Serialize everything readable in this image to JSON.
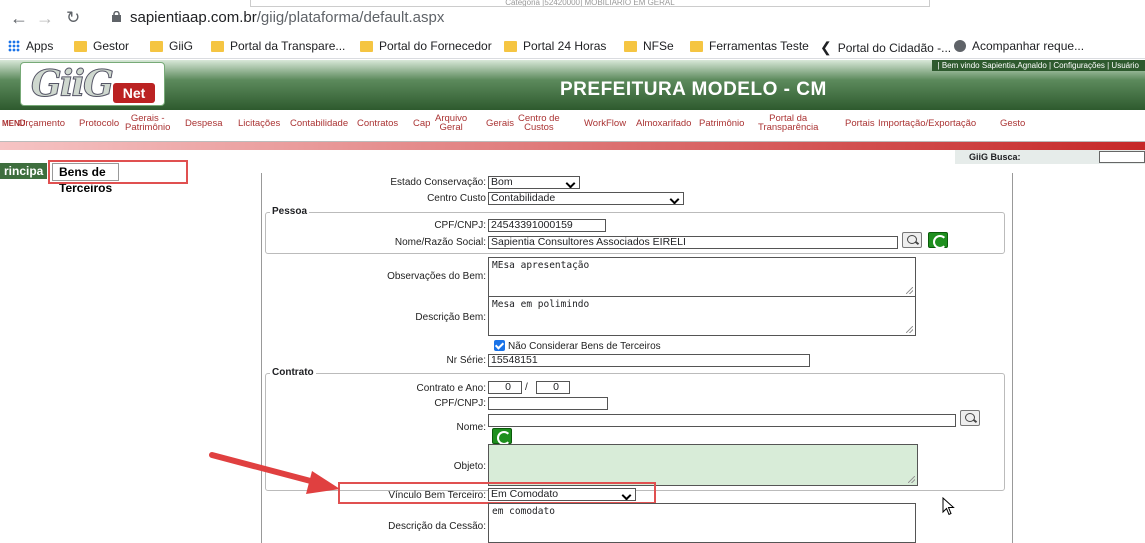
{
  "browser": {
    "url_domain": "sapientiaap.com.br",
    "url_path": "/giig/plataforma/default.aspx",
    "ghost_text": "Categoria [52420000] MOBILIARIO EM GERAL",
    "bookmarks": [
      "Apps",
      "Gestor",
      "GiiG",
      "Portal da Transpare...",
      "Portal do Fornecedor",
      "Portal 24 Horas",
      "NFSe",
      "Ferramentas Teste",
      "Portal do Cidadão -...",
      "Acompanhar reque..."
    ]
  },
  "header": {
    "topbar": "| Bem vindo Sapientia.Agnaldo   |  Configurações   |  Usuário",
    "logo_main": "GiiG",
    "logo_sub": "Net",
    "title": "PREFEITURA MODELO - CM"
  },
  "menu": {
    "tag": "MENU",
    "items": [
      "Orçamento",
      "Protocolo",
      "Gerais -\nPatrimônio",
      "Despesa",
      "Licitações",
      "Contabilidade",
      "Contratos",
      "Cap",
      "Arquivo\nGeral",
      "Gerais",
      "Centro de\nCustos",
      "WorkFlow",
      "Almoxarifado",
      "Patrimônio",
      "Portal da\nTransparência",
      "Portais",
      "Importação/Exportação",
      "Gesto"
    ]
  },
  "busca": {
    "label": "GiiG Busca:"
  },
  "tabs": {
    "principal": "rincipa",
    "active": "Bens de Terceiros"
  },
  "form": {
    "estado_label": "Estado Conservação:",
    "estado_value": "Bom",
    "centro_label": "Centro Custo",
    "centro_value": "Contabilidade",
    "pessoa_legend": "Pessoa",
    "cpf_label": "CPF/CNPJ:",
    "cpf_value": "24543391000159",
    "nome_label": "Nome/Razão Social:",
    "nome_value": "Sapientia Consultores Associados EIRELI",
    "obs_label": "Observações do Bem:",
    "obs_value": "MEsa apresentação",
    "desc_label": "Descrição Bem:",
    "desc_value": "Mesa em polimindo",
    "nao_considerar": "Não Considerar Bens de Terceiros",
    "serie_label": "Nr Série:",
    "serie_value": "15548151",
    "contrato_legend": "Contrato",
    "contrato_ano_label": "Contrato e Ano:",
    "contrato_num": "0",
    "contrato_ano": "0",
    "c_cpf_label": "CPF/CNPJ:",
    "c_nome_label": "Nome:",
    "objeto_label": "Objeto:",
    "vinculo_label": "Vínculo Bem Terceiro:",
    "vinculo_value": "Em Comodato",
    "cessao_label": "Descrição da Cessão:",
    "cessao_value": "em comodato"
  }
}
